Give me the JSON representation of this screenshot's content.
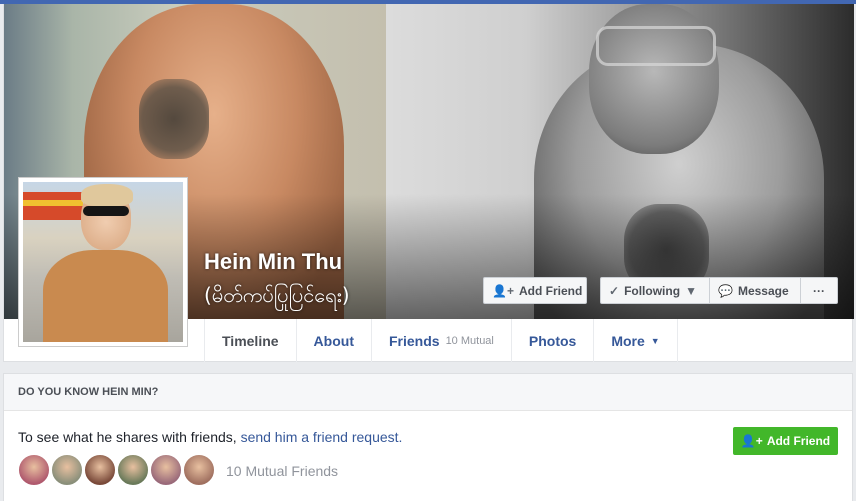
{
  "profile": {
    "name": "Hein Min Thu",
    "alternate_name": "(မိတ်ကပ်ပြုပြင်ရေး)"
  },
  "actions": {
    "add_friend": "Add Friend",
    "following": "Following",
    "message": "Message",
    "more": "···"
  },
  "tabs": [
    {
      "label": "Timeline",
      "active": true
    },
    {
      "label": "About"
    },
    {
      "label": "Friends",
      "badge": "10 Mutual"
    },
    {
      "label": "Photos"
    },
    {
      "label": "More"
    }
  ],
  "pymk": {
    "heading": "DO YOU KNOW HEIN MIN?",
    "text": "To see what he shares with friends, ",
    "link": "send him a friend request.",
    "button": "Add Friend",
    "mutual_count": "10 Mutual Friends",
    "face_colors": [
      "#b05a6e",
      "#8a8f7a",
      "#7a4a3a",
      "#6a7a5a",
      "#9a6a7a",
      "#a07060"
    ]
  },
  "colors": {
    "link": "#365899",
    "green": "#42b72a",
    "brand": "#4267b2"
  }
}
